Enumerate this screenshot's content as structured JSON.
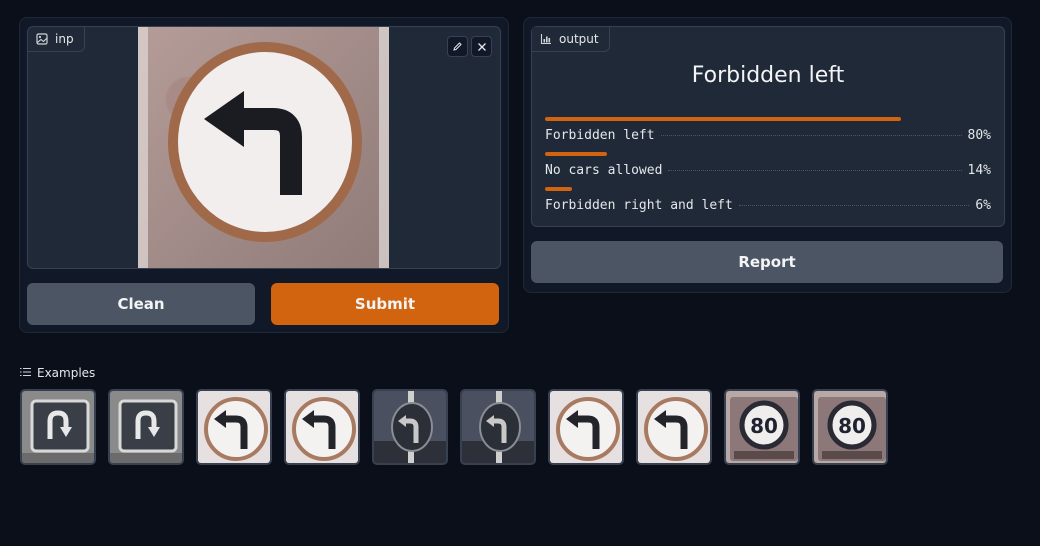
{
  "input": {
    "label": "inp"
  },
  "buttons": {
    "clean": "Clean",
    "submit": "Submit",
    "report": "Report"
  },
  "output": {
    "label": "output",
    "prediction": "Forbidden left",
    "confidences": [
      {
        "label": "Forbidden left",
        "percent": "80%",
        "value": 0.8
      },
      {
        "label": "No cars allowed",
        "percent": "14%",
        "value": 0.14
      },
      {
        "label": "Forbidden right and left",
        "percent": "6%",
        "value": 0.06
      }
    ]
  },
  "examples": {
    "label": "Examples",
    "items": [
      {
        "type": "u-turn"
      },
      {
        "type": "u-turn"
      },
      {
        "type": "forbidden-left"
      },
      {
        "type": "forbidden-left"
      },
      {
        "type": "dark-left"
      },
      {
        "type": "dark-left"
      },
      {
        "type": "forbidden-left"
      },
      {
        "type": "forbidden-left"
      },
      {
        "type": "speed-80",
        "text": "80"
      },
      {
        "type": "speed-80",
        "text": "80"
      }
    ]
  },
  "colors": {
    "accent": "#d2630f",
    "background": "#0b0f19",
    "panel": "#1f2937"
  }
}
